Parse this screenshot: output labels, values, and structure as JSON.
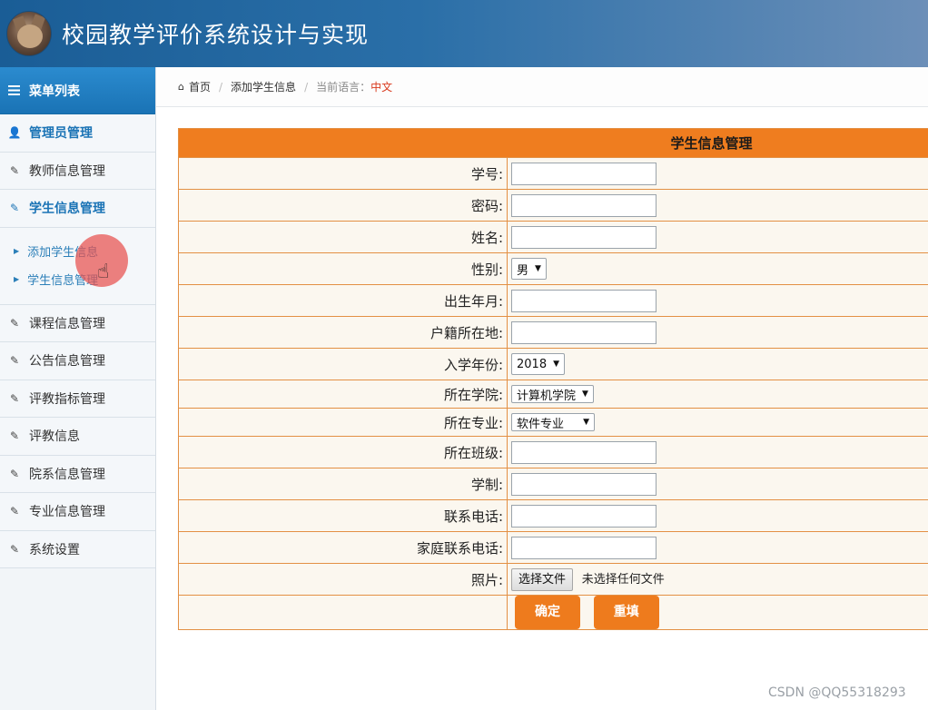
{
  "header": {
    "title": "校园教学评价系统设计与实现"
  },
  "sidebar": {
    "menu_title": "菜单列表",
    "items": [
      {
        "label": "管理员管理",
        "icon": "user-icon"
      },
      {
        "label": "教师信息管理",
        "icon": "edit-icon"
      },
      {
        "label": "学生信息管理",
        "icon": "edit-icon"
      },
      {
        "label": "课程信息管理",
        "icon": "edit-icon"
      },
      {
        "label": "公告信息管理",
        "icon": "edit-icon"
      },
      {
        "label": "评教指标管理",
        "icon": "edit-icon"
      },
      {
        "label": "评教信息",
        "icon": "edit-icon"
      },
      {
        "label": "院系信息管理",
        "icon": "edit-icon"
      },
      {
        "label": "专业信息管理",
        "icon": "edit-icon"
      },
      {
        "label": "系统设置",
        "icon": "edit-icon"
      }
    ],
    "subitems": [
      {
        "label": "添加学生信息"
      },
      {
        "label": "学生信息管理"
      }
    ]
  },
  "breadcrumb": {
    "home": "首页",
    "current": "添加学生信息",
    "lang_label": "当前语言：",
    "lang_value": "中文"
  },
  "form": {
    "title": "学生信息管理",
    "labels": {
      "student_no": "学号:",
      "password": "密码:",
      "name": "姓名:",
      "gender": "性别:",
      "birth": "出生年月:",
      "hometown": "户籍所在地:",
      "enroll_year": "入学年份:",
      "college": "所在学院:",
      "major": "所在专业:",
      "class": "所在班级:",
      "duration": "学制:",
      "phone": "联系电话:",
      "family_phone": "家庭联系电话:",
      "photo": "照片:"
    },
    "values": {
      "gender": "男",
      "enroll_year": "2018",
      "college": "计算机学院",
      "major": "软件专业"
    },
    "file_button": "选择文件",
    "file_status": "未选择任何文件",
    "submit": "确定",
    "reset": "重填"
  },
  "colors": {
    "accent": "#ef7d1f",
    "primary": "#1a73b5",
    "header": "#1a5d96"
  },
  "watermark": "CSDN @QQ55318293"
}
